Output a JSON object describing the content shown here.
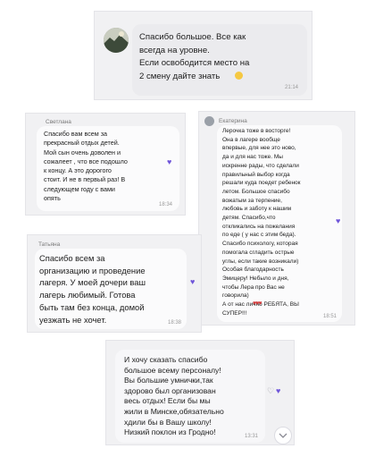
{
  "messages": [
    {
      "text": "Спасибо большое. Все как\nвсегда на уровне.\nЕсли освободится место на\n2 смену дайте знать",
      "time": "21:14",
      "emoji": "smiling-face-icon"
    },
    {
      "sender": "Светлана",
      "text": "Спасибо вам всем за\nпрекрасный отдых детей.\nМой сын очень доволен и\nсожалеет , что все подошло\nк концу. А это дорогого\nстоит. И не в первый раз! В\nследующем году с вами\nопять",
      "time": "18:34"
    },
    {
      "sender": "Екатерина",
      "text": "Лерочка тоже в восторге!\nОна в лагере вообще\nвпервые, для нее это ново,\nда и для нас тоже. Мы\nискренне рады, что сделали\nправильный выбор когда\nрешали куда поедет ребенок\nлетом. Большое спасибо\nвожатым за терпение,\nлюбовь и заботу к нашим\nдетям. Спасибо,что\nоткликались на пожелания\nпо еде ( у нас с этим беда).\nСпасибо психологу, которая\nпомогала сгладить острые\nуглы, если такие возникали)\nОсобая благодарность\nЭмицеру! Небыло и дня,\nчтобы Лера про Вас не\nговорила)\nА от нас лично РЕБЯТА, ВЫ\nСУПЕР!!!",
      "time": "18:51",
      "emoji_count": 3
    },
    {
      "sender": "Татьяна",
      "text": "Спасибо всем за\nорганизацию и проведение\nлагеря. У моей дочери ваш\nлагерь любимый. Готова\nбыть там без конца, домой\nуезжать не хочет.",
      "time": "18:38"
    },
    {
      "text": "И хочу сказать спасибо\nбольшое всему персоналу!\nВы большие умнички,так\nздорово был организован\nвесь отдых! Если бы мы\nжили в Минске,обязательно\nхдили бы в Вашу школу!\nНизкий поклон из Гродно!",
      "time": "13:31"
    }
  ],
  "colors": {
    "reaction_heart": "#6f55d9",
    "bubble": "#ececef",
    "card": "#f1f1f3"
  }
}
